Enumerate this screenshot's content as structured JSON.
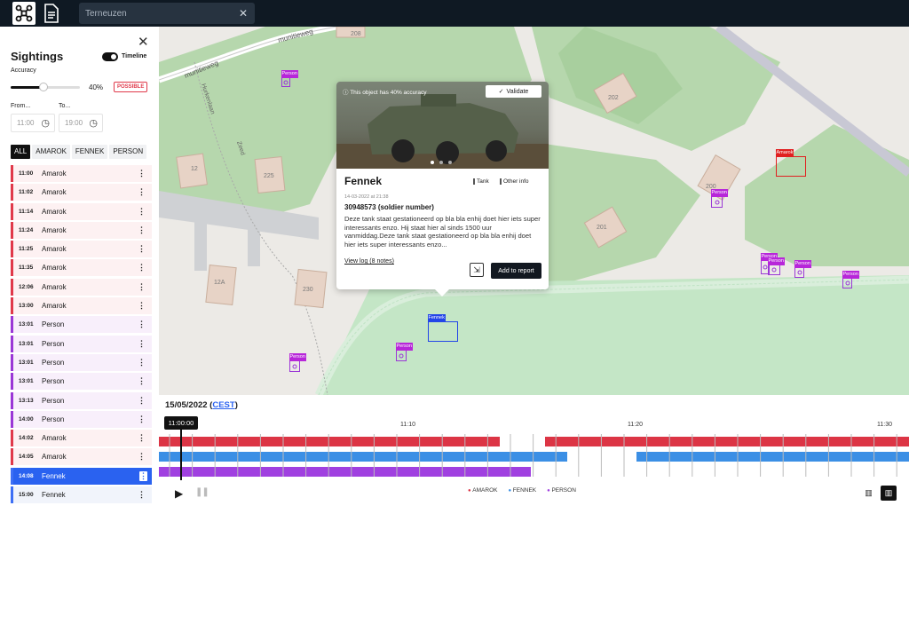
{
  "search": {
    "value": "Terneuzen"
  },
  "sidebar": {
    "title": "Sightings",
    "timeline_label": "Timeline",
    "accuracy_label": "Accuracy",
    "accuracy_value": "40%",
    "accuracy_fraction": 0.47,
    "accuracy_badge": "POSSIBLE",
    "from_label": "From...",
    "to_label": "To...",
    "from_value": "11:00",
    "to_value": "19:00",
    "filters": [
      "ALL",
      "AMAROK",
      "FENNEK",
      "PERSON"
    ],
    "rows": [
      {
        "time": "11:00",
        "name": "Amarok",
        "type": "amarok"
      },
      {
        "time": "11:02",
        "name": "Amarok",
        "type": "amarok"
      },
      {
        "time": "11:14",
        "name": "Amarok",
        "type": "amarok"
      },
      {
        "time": "11:24",
        "name": "Amarok",
        "type": "amarok"
      },
      {
        "time": "11:25",
        "name": "Amarok",
        "type": "amarok"
      },
      {
        "time": "11:35",
        "name": "Amarok",
        "type": "amarok"
      },
      {
        "time": "12:06",
        "name": "Amarok",
        "type": "amarok"
      },
      {
        "time": "13:00",
        "name": "Amarok",
        "type": "amarok"
      },
      {
        "time": "13:01",
        "name": "Person",
        "type": "person"
      },
      {
        "time": "13:01",
        "name": "Person",
        "type": "person"
      },
      {
        "time": "13:01",
        "name": "Person",
        "type": "person"
      },
      {
        "time": "13:01",
        "name": "Person",
        "type": "person"
      },
      {
        "time": "13:13",
        "name": "Person",
        "type": "person"
      },
      {
        "time": "14:00",
        "name": "Person",
        "type": "person"
      },
      {
        "time": "14:02",
        "name": "Amarok",
        "type": "amarok"
      },
      {
        "time": "14:05",
        "name": "Amarok",
        "type": "amarok"
      },
      {
        "time": "14:08",
        "name": "Fennek",
        "type": "fennek",
        "selected": true
      },
      {
        "time": "15:00",
        "name": "Fennek",
        "type": "fennek"
      }
    ]
  },
  "map": {
    "street_labels": [
      "munitieweg",
      "munitieweg",
      "Hurkenlaan",
      "Zeed"
    ],
    "house_numbers": [
      "208",
      "202",
      "12",
      "225",
      "201",
      "200",
      "12A",
      "230"
    ],
    "detections": [
      {
        "label": "Person",
        "kind": "p"
      },
      {
        "label": "Amarok",
        "kind": "a"
      },
      {
        "label": "Person",
        "kind": "p"
      },
      {
        "label": "Person",
        "kind": "p"
      },
      {
        "label": "Person",
        "kind": "p"
      },
      {
        "label": "Person",
        "kind": "p"
      },
      {
        "label": "Person",
        "kind": "p"
      },
      {
        "label": "Person",
        "kind": "p"
      },
      {
        "label": "Fennek",
        "kind": "f"
      },
      {
        "label": "Person",
        "kind": "p"
      }
    ]
  },
  "popup": {
    "accuracy_note": "This object has 40% accuracy",
    "validate_label": "Validate",
    "title": "Fennek",
    "tag1": "Tank",
    "tag2": "Other info",
    "date": "14-03-2022 at 21:38",
    "id": "30948573 (soldier number)",
    "description": "Deze tank staat gestationeerd op bla bla enhij doet hier iets super interessants enzo. Hij staat hier al sinds 1500 uur vanmiddag.Deze tank staat gestationeerd op bla bla enhij doet hier iets super interessants enzo...",
    "log_link": "View log (8 notes)",
    "add_label": "Add to report"
  },
  "timeline": {
    "date": "15/05/2022",
    "tz": "CEST",
    "cursor": "11:00:00",
    "ticks": [
      "11:10",
      "11:20",
      "11:30"
    ],
    "legend": [
      "AMAROK",
      "FENNEK",
      "PERSON"
    ],
    "colors": {
      "amarok": "#dc3545",
      "fennek": "#3b8fe5",
      "person": "#a040e0"
    }
  }
}
